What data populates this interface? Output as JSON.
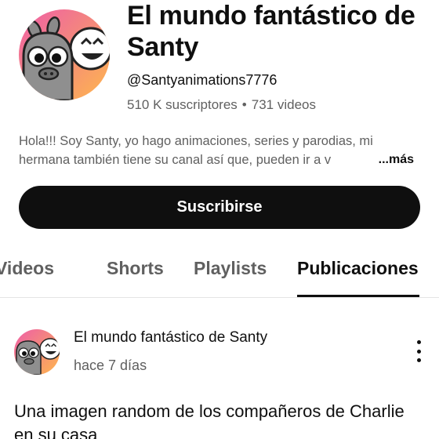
{
  "channel": {
    "name": "El mundo fantástico de Santy",
    "handle": "@Santyanimations7776",
    "subscribers": "510 K suscriptores",
    "separator": "•",
    "videos": "731 videos",
    "description_line1": "Hola!!! Soy Santy, yo hago animaciones, series y parodias, mi",
    "description_line2": "hermana también tiene su canal así que, pueden ir a v",
    "more_label": "...más",
    "subscribe_label": "Suscribirse"
  },
  "tabs": [
    {
      "label": "Videos"
    },
    {
      "label": "Shorts"
    },
    {
      "label": "Playlists"
    },
    {
      "label": "Publicaciones",
      "active": true
    }
  ],
  "post": {
    "author": "El mundo fantástico de Santy",
    "time": "hace 7 días",
    "text": "Una imagen random de los compañeros de Charlie en su casa"
  },
  "colors": {
    "primary_text": "#0f0f0f",
    "secondary_text": "#606060",
    "button_bg": "#0f0f0f",
    "avatar_gradient": [
      "#f06292",
      "#ffb74d"
    ]
  }
}
